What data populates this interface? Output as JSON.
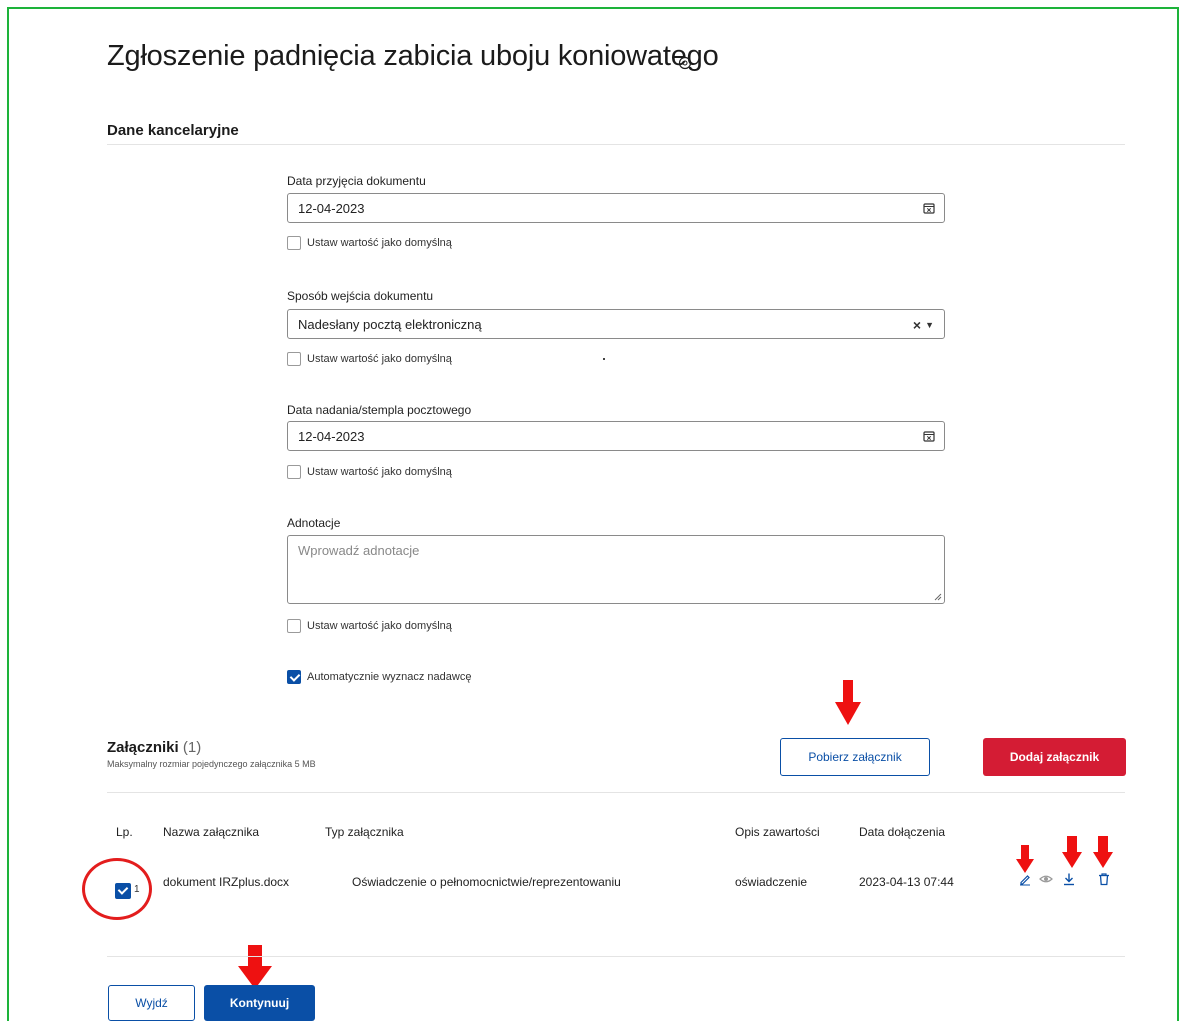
{
  "page": {
    "title": "Zgłoszenie padnięcia zabicia uboju koniowatego"
  },
  "office_data": {
    "section_title": "Dane kancelaryjne",
    "set_default_label": "Ustaw wartość jako domyślną",
    "fields": {
      "doc_received_date": {
        "label": "Data przyjęcia dokumentu",
        "value": "12-04-2023",
        "default_checked": false
      },
      "doc_entry_method": {
        "label": "Sposób wejścia dokumentu",
        "value": "Nadesłany pocztą elektroniczną",
        "default_checked": false
      },
      "postmark_date": {
        "label": "Data nadania/stempla pocztowego",
        "value": "12-04-2023",
        "default_checked": false
      },
      "annotations": {
        "label": "Adnotacje",
        "placeholder": "Wprowadź adnotacje",
        "value": "",
        "default_checked": false
      }
    },
    "auto_sender": {
      "label": "Automatycznie wyznacz nadawcę",
      "checked": true
    }
  },
  "attachments": {
    "title": "Załączniki",
    "count": "(1)",
    "max_size_note": "Maksymalny rozmiar pojedynczego załącznika 5 MB",
    "download_button": "Pobierz załącznik",
    "add_button": "Dodaj załącznik",
    "columns": [
      "Lp.",
      "Nazwa załącznika",
      "Typ załącznika",
      "Opis zawartości",
      "Data dołączenia"
    ],
    "rows": [
      {
        "selected": true,
        "number": "1",
        "name": "dokument IRZplus.docx",
        "type": "Oświadczenie o pełnomocnictwie/reprezentowaniu",
        "description": "oświadczenie",
        "date": "2023-04-13 07:44",
        "actions": [
          "pencil-icon",
          "eye-icon",
          "download-icon",
          "trash-icon"
        ]
      }
    ]
  },
  "footer": {
    "exit_button": "Wyjdź",
    "continue_button": "Kontynuuj"
  },
  "colors": {
    "primary": "#0a4fa6",
    "danger": "#d41c34",
    "annotation_red": "#e31d1d",
    "frame_green": "#1db33a"
  }
}
